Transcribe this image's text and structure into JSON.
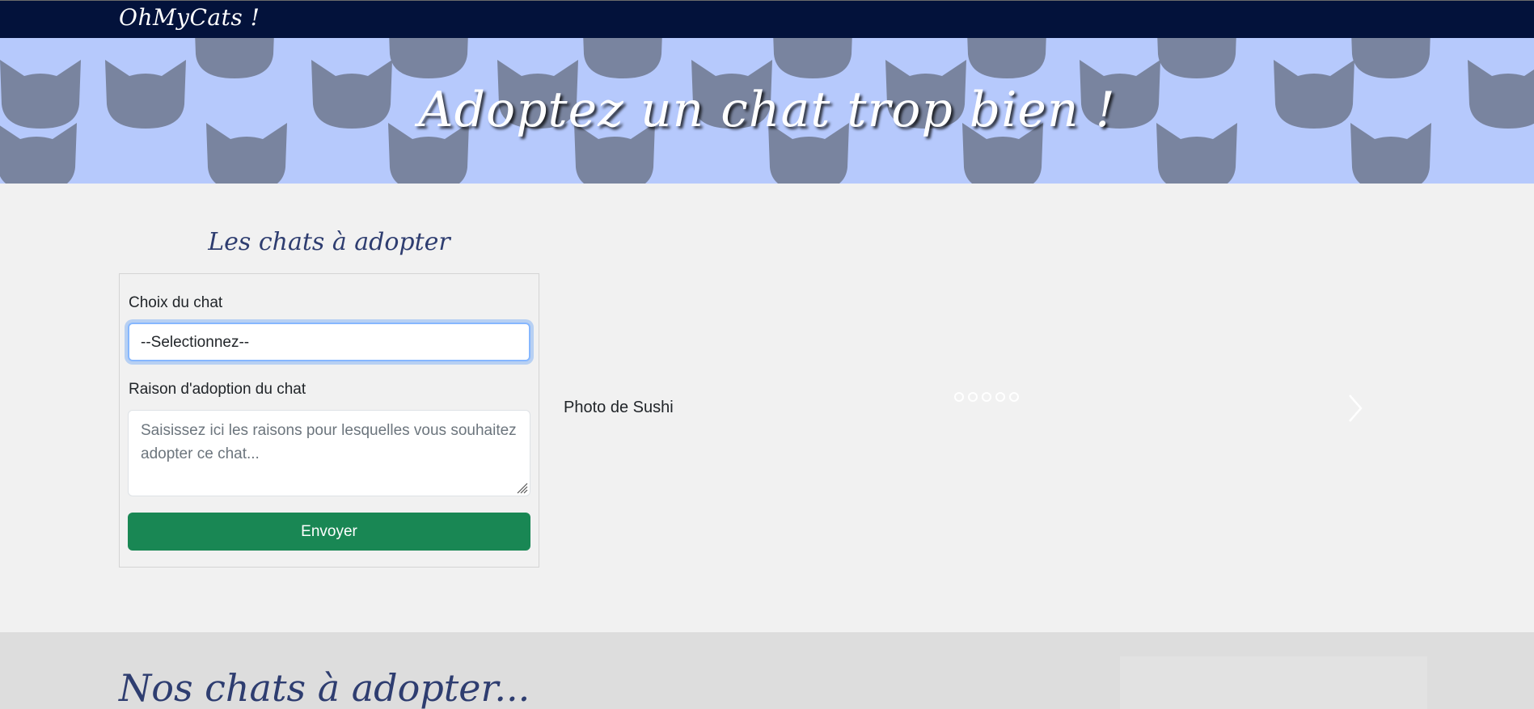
{
  "navbar": {
    "brand": "OhMyCats !"
  },
  "hero": {
    "title": "Adoptez un chat trop bien !",
    "background_color": "#b6c9fc",
    "pattern_icon": "cat-head-icon"
  },
  "adoption": {
    "section_title": "Les chats à adopter",
    "choice_label": "Choix du chat",
    "choice_value": "--Selectionnez--",
    "reason_label": "Raison d'adoption du chat",
    "reason_placeholder": "Saisissez ici les raisons pour lesquelles vous souhaitez adopter ce chat...",
    "submit_label": "Envoyer",
    "submit_color": "#198754"
  },
  "carousel": {
    "caption": "Photo de Sushi",
    "indicator_count": 5,
    "active_indicator": 1,
    "prev_icon": "chevron-left-icon",
    "next_icon": "chevron-right-icon"
  },
  "listing": {
    "title": "Nos chats à adopter..."
  },
  "colors": {
    "navbar": "#03123b",
    "title": "#2e3d70",
    "page_bg": "#f1f1f1"
  }
}
